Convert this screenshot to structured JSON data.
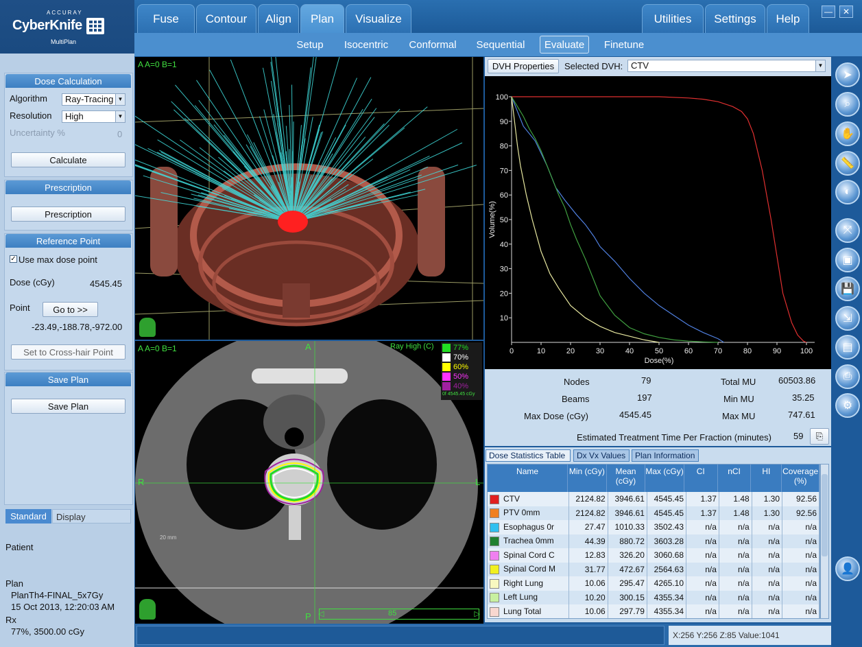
{
  "brand": {
    "acc": "ACCURAY",
    "name": "CyberKnife",
    "product": "MultiPlan"
  },
  "main_tabs": [
    {
      "label": "Fuse"
    },
    {
      "label": "Contour"
    },
    {
      "label": "Align"
    },
    {
      "label": "Plan"
    },
    {
      "label": "Visualize"
    }
  ],
  "right_tabs": [
    {
      "label": "Utilities"
    },
    {
      "label": "Settings"
    },
    {
      "label": "Help"
    }
  ],
  "sub_tabs": [
    {
      "label": "Setup"
    },
    {
      "label": "Isocentric"
    },
    {
      "label": "Conformal"
    },
    {
      "label": "Sequential"
    },
    {
      "label": "Evaluate"
    },
    {
      "label": "Finetune"
    }
  ],
  "left": {
    "dose_calc_title": "Dose Calculation",
    "algorithm_label": "Algorithm",
    "algorithm_value": "Ray-Tracing",
    "resolution_label": "Resolution",
    "resolution_value": "High",
    "uncertainty_label": "Uncertainty %",
    "uncertainty_value": "0",
    "calculate": "Calculate",
    "prescription_title": "Prescription",
    "prescription_btn": "Prescription",
    "refpoint_title": "Reference Point",
    "use_max": "Use max dose point",
    "dose_label": "Dose (cGy)",
    "dose_value": "4545.45",
    "point_label": "Point",
    "goto": "Go to >>",
    "point_coords": "-23.49,-188.78,-972.00",
    "crosshair": "Set to Cross-hair Point",
    "save_title": "Save Plan",
    "save_btn": "Save Plan",
    "tab_standard": "Standard",
    "tab_display": "Display",
    "patient_label": "Patient",
    "plan_label": "Plan",
    "plan_name": "PlanTh4-FINAL_5x7Gy",
    "plan_date": "15 Oct 2013, 12:20:03 AM",
    "rx_label": "Rx",
    "rx_value": "77%, 3500.00 cGy"
  },
  "view3d": {
    "overlay": "A  A=0 B=1"
  },
  "viewct": {
    "overlay": "A  A=0 B=1",
    "top": "A",
    "bottom": "P",
    "left": "R",
    "right": "L",
    "scale": "20 mm",
    "slice": "85",
    "legend_title": "Ray High (C)",
    "isodose": [
      {
        "label": "77%",
        "color": "#22dd22"
      },
      {
        "label": "70%",
        "color": "#ffffff"
      },
      {
        "label": "60%",
        "color": "#ffff00"
      },
      {
        "label": "50%",
        "color": "#ff33ff"
      },
      {
        "label": "40%",
        "color": "#a020a0"
      }
    ],
    "legend_foot": "0f 4545.45 cGy"
  },
  "dvh": {
    "props_btn": "DVH Properties",
    "selected_label": "Selected DVH:",
    "selected_value": "CTV"
  },
  "chart_data": {
    "type": "line",
    "xlabel": "Dose(%)",
    "ylabel": "Volume(%)",
    "xlim": [
      0,
      100
    ],
    "ylim": [
      0,
      100
    ],
    "xticks": [
      0,
      10,
      20,
      30,
      40,
      50,
      60,
      70,
      80,
      90,
      100
    ],
    "yticks": [
      10,
      20,
      30,
      40,
      50,
      60,
      70,
      80,
      90,
      100
    ],
    "series": [
      {
        "color": "#e03030",
        "x": [
          0,
          10,
          30,
          50,
          60,
          65,
          70,
          75,
          78,
          80,
          82,
          85,
          88,
          90,
          92,
          95,
          97,
          99,
          100
        ],
        "y": [
          100,
          100,
          100,
          100,
          99.5,
          99,
          98,
          96,
          94,
          91,
          85,
          70,
          50,
          35,
          20,
          8,
          3,
          0.5,
          0
        ]
      },
      {
        "color": "#5080e0",
        "x": [
          0,
          1,
          2,
          4,
          8,
          10,
          12,
          15,
          18,
          20,
          22,
          25,
          28,
          30,
          35,
          40,
          45,
          50,
          55,
          60,
          65,
          70,
          72
        ],
        "y": [
          100,
          97,
          94,
          88,
          82,
          77,
          72,
          63,
          58,
          55,
          52,
          48,
          43,
          39,
          33,
          26,
          20,
          15,
          11,
          7,
          4,
          1.5,
          0
        ]
      },
      {
        "color": "#40a040",
        "x": [
          0,
          2,
          4,
          6,
          8,
          10,
          12,
          14,
          16,
          18,
          20,
          22,
          25,
          28,
          30,
          35,
          40,
          45,
          50,
          55,
          60,
          65,
          70
        ],
        "y": [
          100,
          96,
          92,
          87,
          83,
          78,
          72,
          66,
          60,
          55,
          48,
          42,
          34,
          25,
          19,
          11,
          6,
          3.5,
          2,
          1,
          0.5,
          0.2,
          0
        ]
      },
      {
        "color": "#e8e8a0",
        "x": [
          0,
          1,
          2,
          3,
          5,
          7,
          10,
          13,
          16,
          20,
          25,
          30,
          35,
          40,
          45,
          50
        ],
        "y": [
          100,
          90,
          80,
          72,
          60,
          50,
          37,
          28,
          22,
          15,
          10,
          6.5,
          4,
          2.5,
          1,
          0
        ]
      }
    ]
  },
  "stats": {
    "nodes_label": "Nodes",
    "nodes": "79",
    "beams_label": "Beams",
    "beams": "197",
    "maxdose_label": "Max Dose (cGy)",
    "maxdose": "4545.45",
    "totalmu_label": "Total MU",
    "totalmu": "60503.86",
    "minmu_label": "Min MU",
    "minmu": "35.25",
    "maxmu_label": "Max MU",
    "maxmu": "747.61",
    "time_label": "Estimated Treatment Time Per Fraction (minutes)",
    "time": "59"
  },
  "dose_tabs": [
    {
      "label": "Dose Statistics Table"
    },
    {
      "label": "Dx Vx Values"
    },
    {
      "label": "Plan Information"
    }
  ],
  "dose_table": {
    "headers": [
      "Name",
      "Min (cGy)",
      "Mean (cGy)",
      "Max (cGy)",
      "CI",
      "nCI",
      "HI",
      "Coverage (%)"
    ],
    "rows": [
      {
        "color": "#e02020",
        "cells": [
          "CTV",
          "2124.82",
          "3946.61",
          "4545.45",
          "1.37",
          "1.48",
          "1.30",
          "92.56"
        ]
      },
      {
        "color": "#f08020",
        "cells": [
          "PTV 0mm",
          "2124.82",
          "3946.61",
          "4545.45",
          "1.37",
          "1.48",
          "1.30",
          "92.56"
        ]
      },
      {
        "color": "#30c0f0",
        "cells": [
          "Esophagus 0r",
          "27.47",
          "1010.33",
          "3502.43",
          "n/a",
          "n/a",
          "n/a",
          "n/a"
        ]
      },
      {
        "color": "#208030",
        "cells": [
          "Trachea 0mm",
          "44.39",
          "880.72",
          "3603.28",
          "n/a",
          "n/a",
          "n/a",
          "n/a"
        ]
      },
      {
        "color": "#f080f0",
        "cells": [
          "Spinal Cord C",
          "12.83",
          "326.20",
          "3060.68",
          "n/a",
          "n/a",
          "n/a",
          "n/a"
        ]
      },
      {
        "color": "#f0f020",
        "cells": [
          "Spinal Cord M",
          "31.77",
          "472.67",
          "2564.63",
          "n/a",
          "n/a",
          "n/a",
          "n/a"
        ]
      },
      {
        "color": "#f8f8c0",
        "cells": [
          "Right Lung",
          "10.06",
          "295.47",
          "4265.10",
          "n/a",
          "n/a",
          "n/a",
          "n/a"
        ]
      },
      {
        "color": "#c8f0a0",
        "cells": [
          "Left Lung",
          "10.20",
          "300.15",
          "4355.34",
          "n/a",
          "n/a",
          "n/a",
          "n/a"
        ]
      },
      {
        "color": "#f8d8d0",
        "cells": [
          "Lung Total",
          "10.06",
          "297.79",
          "4355.34",
          "n/a",
          "n/a",
          "n/a",
          "n/a"
        ]
      }
    ]
  },
  "status": {
    "coords": "X:256 Y:256 Z:85  Value:1041"
  }
}
